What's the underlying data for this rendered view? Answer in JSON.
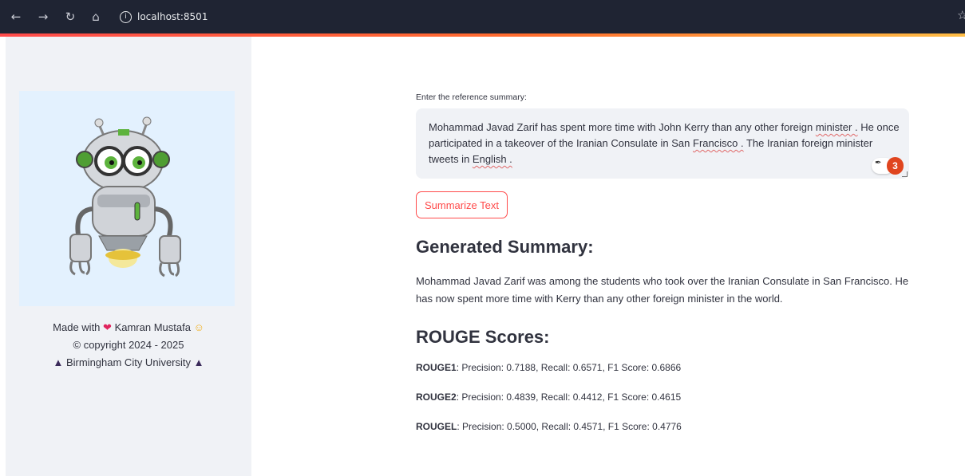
{
  "browser": {
    "url": "localhost:8501",
    "back_icon": "arrow-left-icon",
    "forward_icon": "arrow-right-icon",
    "reload_icon": "reload-icon",
    "home_icon": "home-icon"
  },
  "sidebar": {
    "image_icon": "robot-mascot",
    "footer_line1_prefix": "Made with",
    "footer_line1_name": "Kamran Mustafa",
    "footer_line2": "© copyright 2024 - 2025",
    "footer_line3": "Birmingham City University"
  },
  "main": {
    "input_label": "Enter the reference summary:",
    "reference_text": {
      "p1": "Mohammad Javad Zarif has spent more time with John Kerry than any other foreign ",
      "w1": "minister .",
      "p2": " He once participated in a takeover of the Iranian Consulate in San ",
      "w2": "Francisco .",
      "p3": " The Iranian foreign minister tweets in ",
      "w3": "English ."
    },
    "grammar_badge_count": "3",
    "button_label": "Summarize Text",
    "generated_heading": "Generated Summary:",
    "generated_text": "Mohammad Javad Zarif was among the students who took over the Iranian Consulate in San Francisco. He has now spent more time with Kerry than any other foreign minister in the world.",
    "rouge_heading": "ROUGE Scores:",
    "rouge": [
      {
        "name": "ROUGE1",
        "text": ": Precision: 0.7188, Recall: 0.6571, F1 Score: 0.6866"
      },
      {
        "name": "ROUGE2",
        "text": ": Precision: 0.4839, Recall: 0.4412, F1 Score: 0.4615"
      },
      {
        "name": "ROUGEL",
        "text": ": Precision: 0.5000, Recall: 0.4571, F1 Score: 0.4776"
      }
    ]
  },
  "colors": {
    "accent": "#ff4b4b",
    "sidebar_bg": "#f0f2f6",
    "browser_bar": "#1f2433"
  }
}
